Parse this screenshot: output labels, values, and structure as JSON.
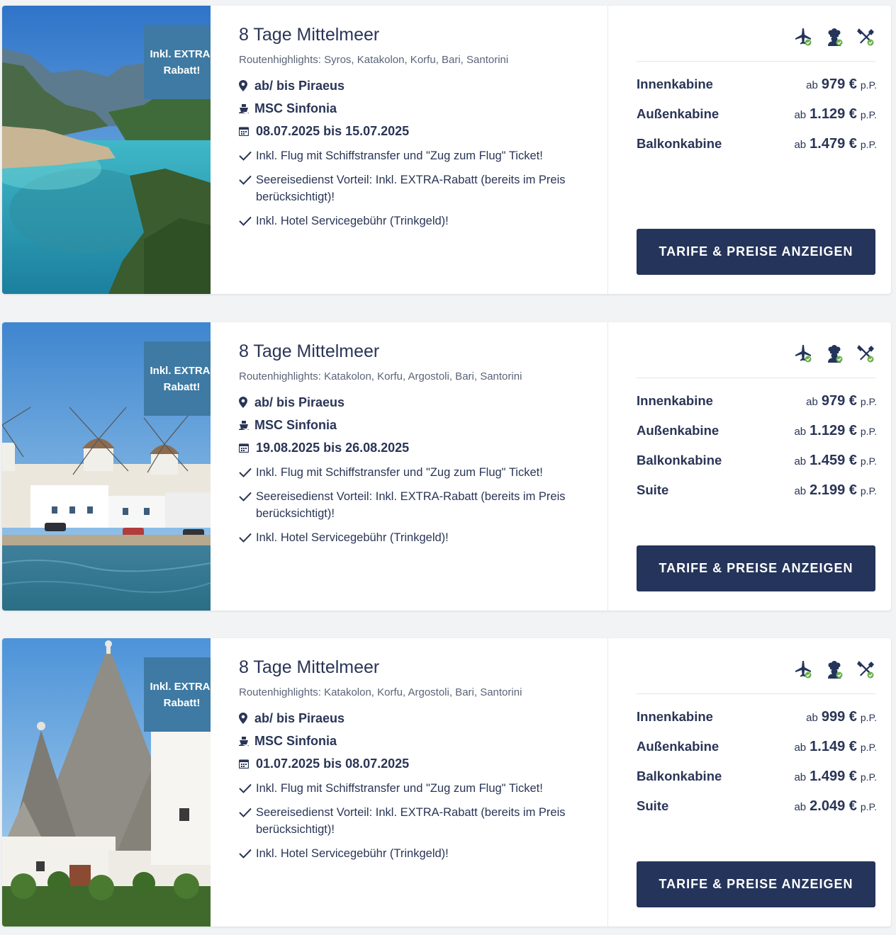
{
  "colors": {
    "navy": "#24345a",
    "badge_blue": "#3e7aa3",
    "green_check": "#6ab04c",
    "text": "#2a3556"
  },
  "service_icons": [
    "plane-included-icon",
    "chef-included-icon",
    "cutlery-included-icon"
  ],
  "cruises": [
    {
      "image": "coastal-bay-with-turquoise-water",
      "badge": "Inkl. EXTRA-Rabatt!",
      "title": "8 Tage Mittelmeer",
      "highlights": "Routenhighlights: Syros, Katakolon, Korfu, Bari, Santorini",
      "port": "ab/ bis Piraeus",
      "ship": "MSC Sinfonia",
      "dates": "08.07.2025 bis 15.07.2025",
      "features": [
        "Inkl. Flug mit Schiffstransfer und \"Zug zum Flug\" Ticket!",
        "Seereisedienst Vorteil: Inkl. EXTRA-Rabatt (bereits im Preis berücksichtigt)!",
        "Inkl. Hotel Servicegebühr (Trinkgeld)!"
      ],
      "cabins": [
        {
          "name": "Innenkabine",
          "ab": "ab",
          "price": "979 €",
          "pp": "p.P."
        },
        {
          "name": "Außenkabine",
          "ab": "ab",
          "price": "1.129 €",
          "pp": "p.P."
        },
        {
          "name": "Balkonkabine",
          "ab": "ab",
          "price": "1.479 €",
          "pp": "p.P."
        }
      ],
      "button": "TARIFE & PREISE ANZEIGEN"
    },
    {
      "image": "windmills-of-mykonos",
      "badge": "Inkl. EXTRA-Rabatt!",
      "title": "8 Tage Mittelmeer",
      "highlights": "Routenhighlights: Katakolon, Korfu, Argostoli, Bari, Santorini",
      "port": "ab/ bis Piraeus",
      "ship": "MSC Sinfonia",
      "dates": "19.08.2025 bis 26.08.2025",
      "features": [
        "Inkl. Flug mit Schiffstransfer und \"Zug zum Flug\" Ticket!",
        "Seereisedienst Vorteil: Inkl. EXTRA-Rabatt (bereits im Preis berücksichtigt)!",
        "Inkl. Hotel Servicegebühr (Trinkgeld)!"
      ],
      "cabins": [
        {
          "name": "Innenkabine",
          "ab": "ab",
          "price": "979 €",
          "pp": "p.P."
        },
        {
          "name": "Außenkabine",
          "ab": "ab",
          "price": "1.129 €",
          "pp": "p.P."
        },
        {
          "name": "Balkonkabine",
          "ab": "ab",
          "price": "1.459 €",
          "pp": "p.P."
        },
        {
          "name": "Suite",
          "ab": "ab",
          "price": "2.199 €",
          "pp": "p.P."
        }
      ],
      "button": "TARIFE & PREISE ANZEIGEN"
    },
    {
      "image": "trulli-houses-alberobello",
      "badge": "Inkl. EXTRA-Rabatt!",
      "title": "8 Tage Mittelmeer",
      "highlights": "Routenhighlights: Katakolon, Korfu, Argostoli, Bari, Santorini",
      "port": "ab/ bis Piraeus",
      "ship": "MSC Sinfonia",
      "dates": "01.07.2025 bis 08.07.2025",
      "features": [
        "Inkl. Flug mit Schiffstransfer und \"Zug zum Flug\" Ticket!",
        "Seereisedienst Vorteil: Inkl. EXTRA-Rabatt (bereits im Preis berücksichtigt)!",
        "Inkl. Hotel Servicegebühr (Trinkgeld)!"
      ],
      "cabins": [
        {
          "name": "Innenkabine",
          "ab": "ab",
          "price": "999 €",
          "pp": "p.P."
        },
        {
          "name": "Außenkabine",
          "ab": "ab",
          "price": "1.149 €",
          "pp": "p.P."
        },
        {
          "name": "Balkonkabine",
          "ab": "ab",
          "price": "1.499 €",
          "pp": "p.P."
        },
        {
          "name": "Suite",
          "ab": "ab",
          "price": "2.049 €",
          "pp": "p.P."
        }
      ],
      "button": "TARIFE & PREISE ANZEIGEN"
    }
  ]
}
